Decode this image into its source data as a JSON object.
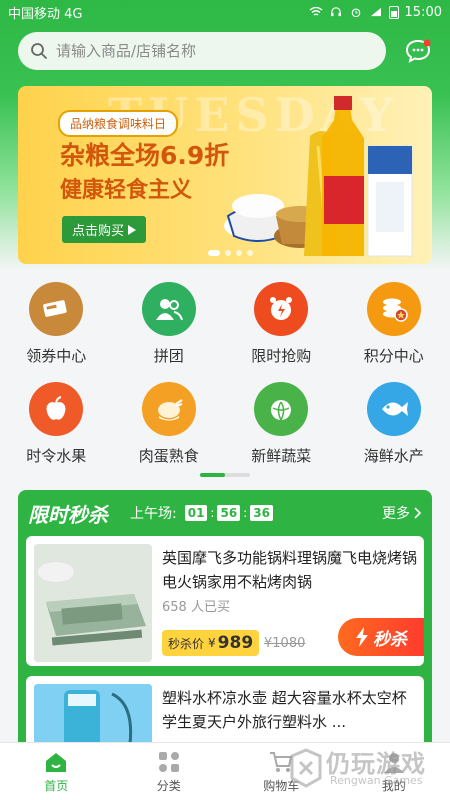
{
  "status_bar": {
    "carrier": "中国移动 4G",
    "time": "15:00"
  },
  "search": {
    "placeholder": "请输入商品/店铺名称"
  },
  "banner": {
    "watermark_text": "TUESDAY",
    "tag": "品纳粮食调味料日",
    "headline": "杂粮全场6.9折",
    "subline": "健康轻食主义",
    "cta": "点击购买",
    "page_count": 4,
    "active_page": 1
  },
  "categories": [
    {
      "label": "领券中心",
      "icon": "coupon-icon",
      "color": "#c9893b"
    },
    {
      "label": "拼团",
      "icon": "group-icon",
      "color": "#2fb060"
    },
    {
      "label": "限时抢购",
      "icon": "alarm-clock-icon",
      "color": "#ee4b1f"
    },
    {
      "label": "积分中心",
      "icon": "coins-icon",
      "color": "#f59a10"
    },
    {
      "label": "时令水果",
      "icon": "apple-icon",
      "color": "#f05a28"
    },
    {
      "label": "肉蛋熟食",
      "icon": "chicken-icon",
      "color": "#f4a024"
    },
    {
      "label": "新鲜蔬菜",
      "icon": "cabbage-icon",
      "color": "#49b34a"
    },
    {
      "label": "海鲜水产",
      "icon": "fish-icon",
      "color": "#35a6e6"
    }
  ],
  "flash_sale": {
    "title": "限时秒杀",
    "session_label": "上午场:",
    "countdown": {
      "h": "01",
      "m": "56",
      "s": "36"
    },
    "more": "更多",
    "products": [
      {
        "name": "英国摩飞多功能锅料理锅魔飞电烧烤锅电火锅家用不粘烤肉锅",
        "sold": "658 人已买",
        "price_label": "秒杀价",
        "currency": "¥",
        "price": "989",
        "old_price": "¥1080",
        "button": "秒杀"
      },
      {
        "name": "塑料水杯凉水壶 超大容量水杯太空杯学生夏天户外旅行塑料水 ..."
      }
    ]
  },
  "tabbar": [
    {
      "label": "首页",
      "icon": "home-icon",
      "active": true
    },
    {
      "label": "分类",
      "icon": "category-icon",
      "active": false
    },
    {
      "label": "购物车",
      "icon": "cart-icon",
      "active": false
    },
    {
      "label": "我的",
      "icon": "profile-icon",
      "active": false
    }
  ],
  "watermark": {
    "main": "仍玩游戏",
    "sub": "Rengwan Games"
  },
  "colors": {
    "primary": "#2fb444",
    "accent": "#ff4a2a",
    "price_bg": "#ffd33d"
  }
}
